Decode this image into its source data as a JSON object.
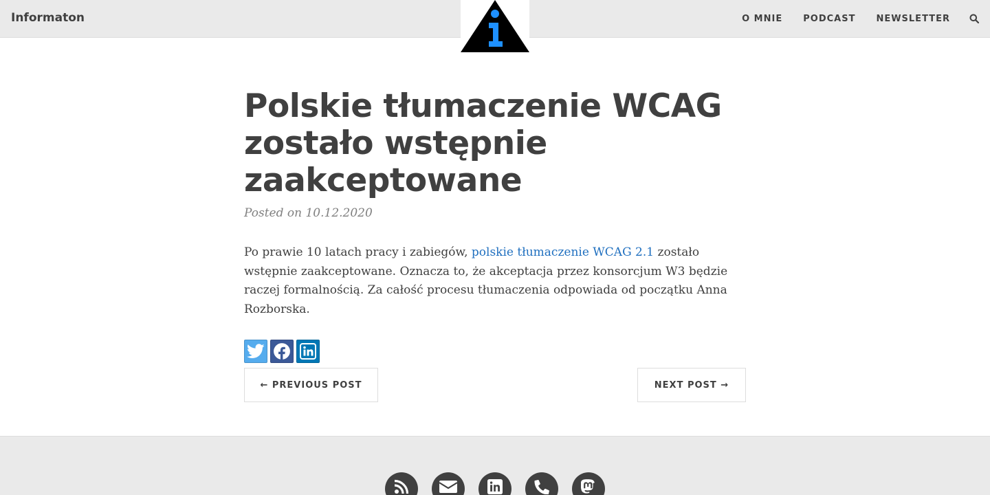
{
  "header": {
    "brand": "Informaton",
    "nav": {
      "about": "O MNIE",
      "podcast": "PODCAST",
      "newsletter": "NEWSLETTER"
    },
    "search_icon": "search-icon",
    "logo_icon": "info-triangle-logo"
  },
  "post": {
    "title": "Polskie tłumaczenie WCAG zostało wstępnie zaakceptowane",
    "meta": "Posted on 10.12.2020",
    "body": {
      "before_link": "Po prawie 10 latach pracy i zabiegów, ",
      "link_text": "polskie tłumaczenie WCAG 2.1",
      "after_link": " zostało wstępnie zaakceptowane. Oznacza to, że akceptacja przez konsorcjum W3 będzie raczej formalnością. Za całość procesu tłumaczenia odpowiada od początku Anna Rozborska."
    },
    "share": [
      "twitter-icon",
      "facebook-icon",
      "linkedin-icon"
    ]
  },
  "pager": {
    "previous": "← PREVIOUS POST",
    "next": "NEXT POST →"
  },
  "footer": {
    "icons": [
      "rss-icon",
      "email-icon",
      "linkedin-icon",
      "phone-icon",
      "mastodon-icon"
    ]
  },
  "colors": {
    "nav_bg": "#eaeaea",
    "text": "#404040",
    "link": "#1f6fbf",
    "logo_blue": "#1e90ff",
    "twitter": "#55acee",
    "facebook": "#3b5998",
    "linkedin": "#0077b5"
  }
}
